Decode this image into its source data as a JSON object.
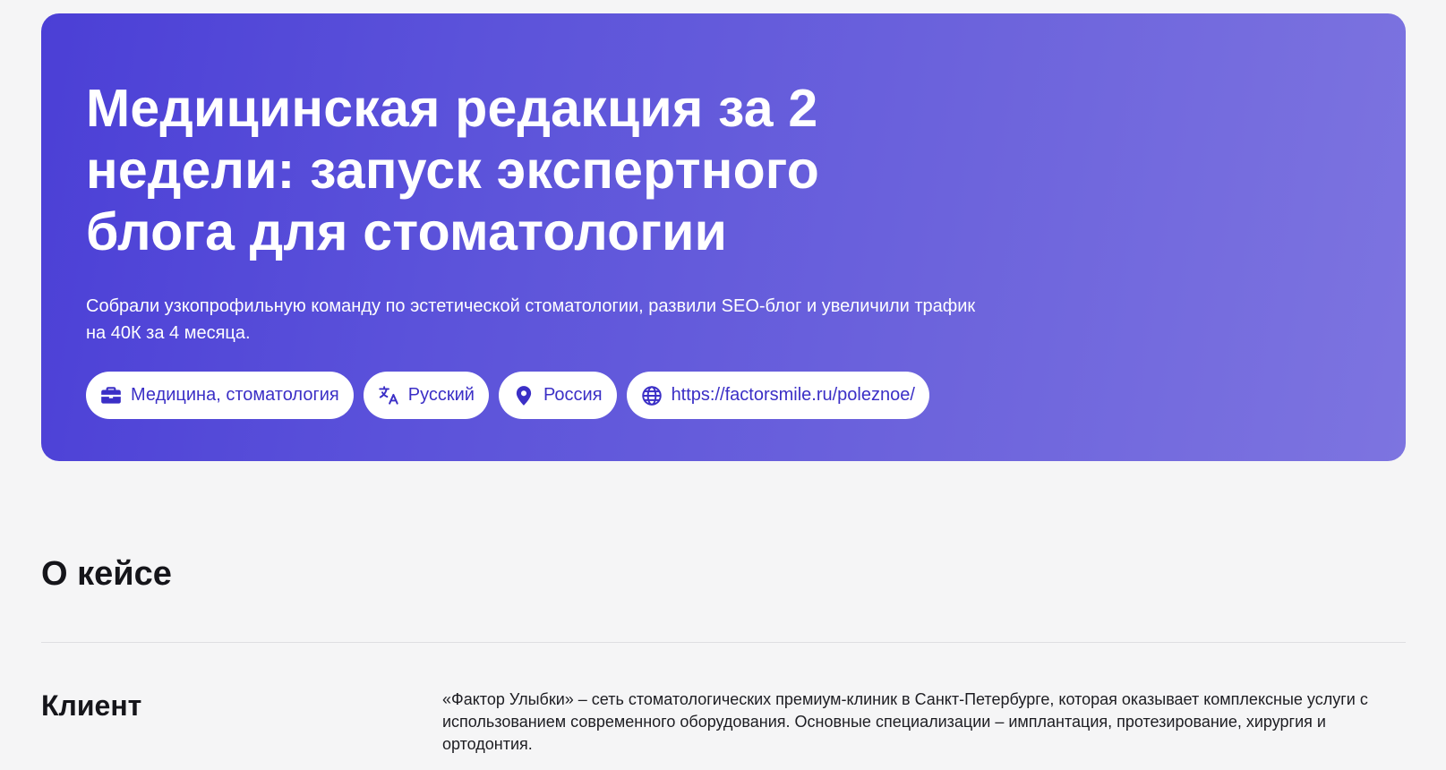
{
  "hero": {
    "title": "Медицинская редакция за 2 недели: запуск экспертного блога для стоматологии",
    "subtitle": "Собрали узкопрофильную команду по эстетической стоматологии, развили SEO-блог и увеличили трафик на 40К за 4 месяца.",
    "gradient_colors": [
      "#4b3fd6",
      "#7d74e0"
    ],
    "chips": [
      {
        "icon": "briefcase-icon",
        "label": "Медицина, стоматология"
      },
      {
        "icon": "translate-icon",
        "label": "Русский"
      },
      {
        "icon": "location-pin-icon",
        "label": "Россия"
      },
      {
        "icon": "globe-icon",
        "label": "https://factorsmile.ru/poleznoe/"
      }
    ],
    "chip_text_color": "#3b2fc6"
  },
  "about": {
    "title": "О кейсе",
    "rows": [
      {
        "label": "Клиент",
        "text": "«Фактор Улыбки» – сеть стоматологических премиум-клиник в Санкт-Петербурге, которая оказывает комплексные услуги с использованием современного оборудования. Основные специализации – имплантация, протезирование, хирургия и ортодонтия."
      }
    ]
  }
}
